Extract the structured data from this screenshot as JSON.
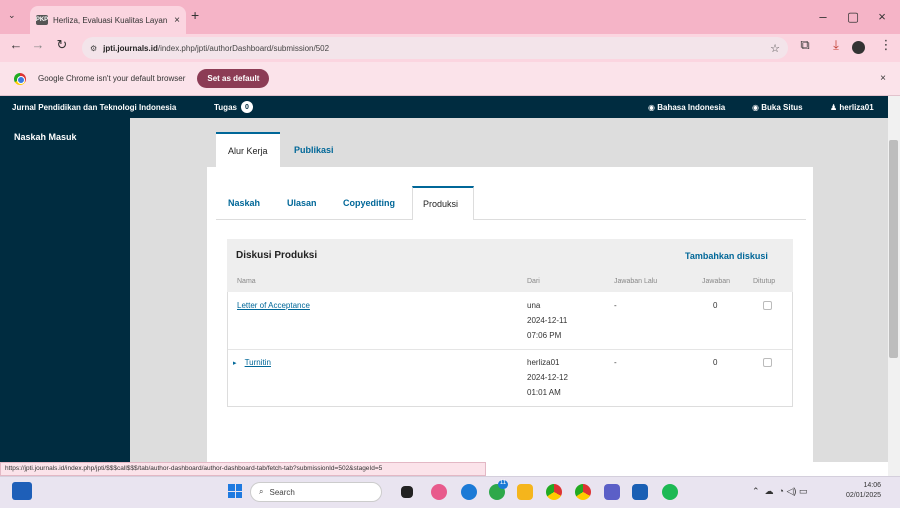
{
  "browser": {
    "tab_title": "Herliza, Evaluasi Kualitas Layan",
    "tab_favicon": "PKP",
    "url_host": "jpti.journals.id",
    "url_path": "/index.php/jpti/authorDashboard/submission/502",
    "minimize": "–",
    "maximize": "▢",
    "close": "×",
    "new_tab": "+",
    "menu_dots": "⋮"
  },
  "infobar": {
    "message": "Google Chrome isn't your default browser",
    "button": "Set as default",
    "close": "×"
  },
  "header": {
    "journal": "Jurnal Pendidikan dan Teknologi Indonesia",
    "tasks_label": "Tugas",
    "tasks_count": "0",
    "language": "Bahasa Indonesia",
    "view_site": "Buka Situs",
    "user": "herliza01"
  },
  "sidebar": {
    "item": "Naskah Masuk"
  },
  "tabs": {
    "workflow": "Alur Kerja",
    "publication": "Publikasi"
  },
  "subtabs": [
    "Naskah",
    "Ulasan",
    "Copyediting",
    "Produksi"
  ],
  "discussions": {
    "title": "Diskusi Produksi",
    "add": "Tambahkan diskusi",
    "columns": [
      "Nama",
      "Dari",
      "Jawaban Lalu",
      "Jawaban",
      "Ditutup"
    ],
    "rows": [
      {
        "name": "Letter of Acceptance",
        "from": "una",
        "date": "2024-12-11",
        "time": "07:06 PM",
        "last_reply": "-",
        "replies": "0",
        "closed": false
      },
      {
        "name": "Turnitin",
        "from": "herliza01",
        "date": "2024-12-12",
        "time": "01:01 AM",
        "last_reply": "-",
        "replies": "0",
        "closed": false
      }
    ]
  },
  "statusbar": {
    "url": "https://jpti.journals.id/index.php/jpti/$$$call$$$/tab/author-dashboard/author-dashboard-tab/fetch-tab?submissionId=502&stageId=5"
  },
  "taskbar": {
    "search_placeholder": "Search",
    "time": "14:06",
    "date": "02/01/2025",
    "chat_badge": "11"
  },
  "colors": {
    "accent": "#006798",
    "header_bg": "#002c40",
    "browser_tab": "#f5b4c7"
  }
}
